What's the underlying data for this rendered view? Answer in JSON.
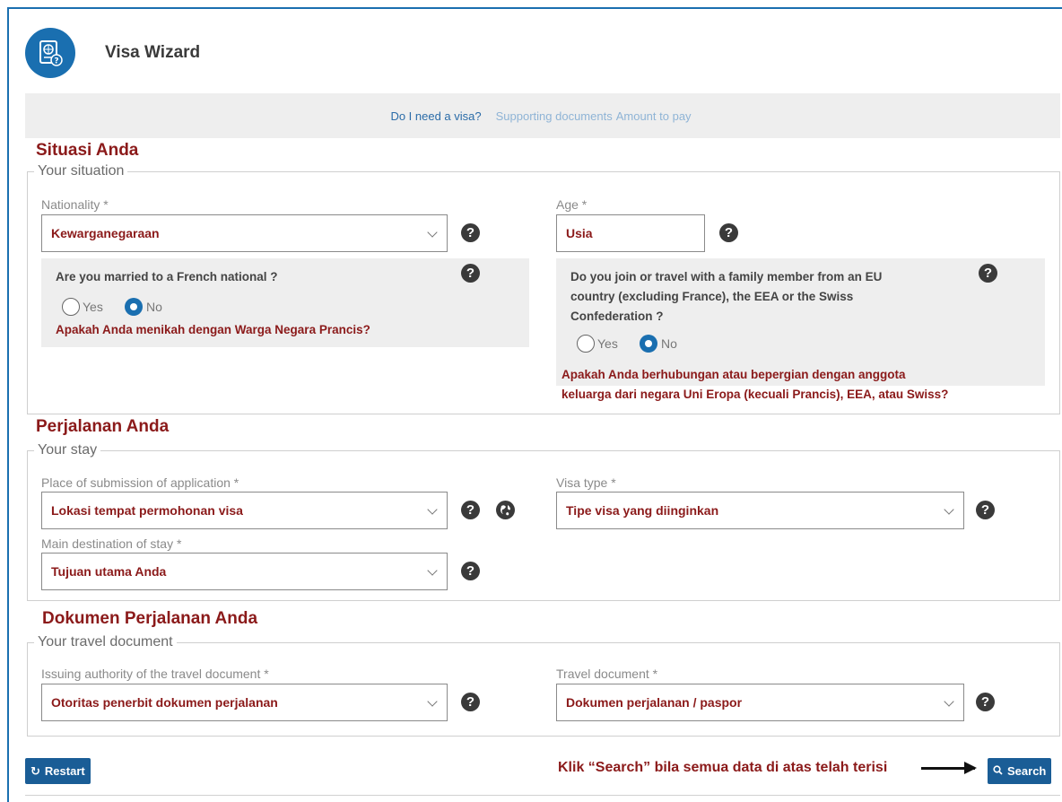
{
  "app": {
    "title": "Visa Wizard"
  },
  "nav": {
    "active": "Do I need a visa?",
    "links": [
      "Supporting documents",
      "Amount to pay"
    ]
  },
  "annotations": {
    "situation_title": "Situasi Anda",
    "stay_title": "Perjalanan Anda",
    "document_title": "Dokumen Perjalanan Anda",
    "married_translation": "Apakah Anda menikah dengan Warga Negara Prancis?",
    "family_translation_line1": "Apakah Anda berhubungan atau bepergian dengan anggota",
    "family_translation_line2": "keluarga dari negara Uni Eropa (kecuali Prancis), EEA, atau Swiss?",
    "search_hint": "Klik “Search” bila semua data di atas telah terisi"
  },
  "situation": {
    "legend": "Your situation",
    "nationality_label": "Nationality *",
    "nationality_value": "Kewarganegaraan",
    "age_label": "Age *",
    "age_value": "Usia",
    "married_question": "Are you married to a French national ?",
    "family_question_line1": "Do you join or travel with a family member from an EU",
    "family_question_line2": "country (excluding France), the EEA or the Swiss",
    "family_question_line3": "Confederation ?",
    "yes_label": "Yes",
    "no_label": "No",
    "married_selected": "No",
    "family_selected": "No"
  },
  "stay": {
    "legend": "Your stay",
    "place_label": "Place of submission of application *",
    "place_value": "Lokasi tempat permohonan visa",
    "visa_type_label": "Visa type *",
    "visa_type_value": "Tipe visa yang diinginkan",
    "destination_label": "Main destination of stay *",
    "destination_value": "Tujuan utama Anda"
  },
  "travel_document": {
    "legend": "Your travel document",
    "authority_label": "Issuing authority of the travel document *",
    "authority_value": "Otoritas penerbit dokumen perjalanan",
    "document_label": "Travel document *",
    "document_value": "Dokumen perjalanan / paspor"
  },
  "buttons": {
    "restart": "Restart",
    "search": "Search"
  },
  "colors": {
    "brand_blue": "#1a6fb0",
    "annotation_red": "#8b1a1a"
  }
}
